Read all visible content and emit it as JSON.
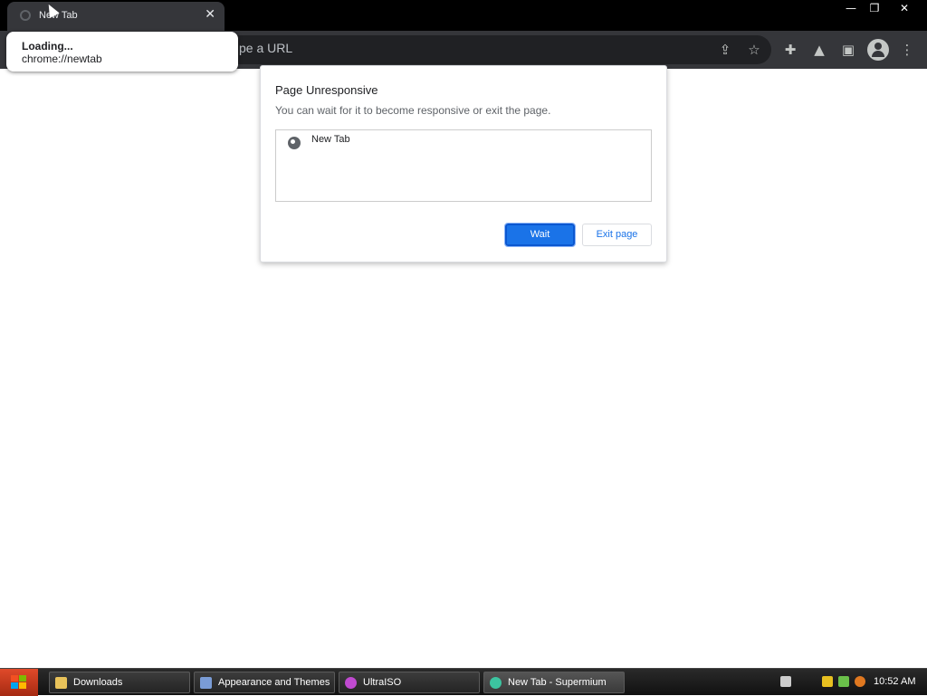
{
  "window": {
    "tab_title": "New Tab",
    "tab_close": "✕",
    "min": "—",
    "max": "❐",
    "close": "✕"
  },
  "toolbar": {
    "omnibox_placeholder": "pe a URL",
    "share": "⇪",
    "star": "☆",
    "extensions": "✚",
    "labs": "▲",
    "side_panel": "▣",
    "menu": "⋮"
  },
  "hovercard": {
    "title": "Loading...",
    "url": "chrome://newtab"
  },
  "dialog": {
    "title": "Page Unresponsive",
    "message": "You can wait for it to become responsive or exit the page.",
    "pages": [
      {
        "label": "New Tab"
      }
    ],
    "wait_label": "Wait",
    "exit_label": "Exit page"
  },
  "taskbar": {
    "tasks": [
      {
        "label": "Downloads",
        "icon_color": "#e8c25a"
      },
      {
        "label": "Appearance and Themes",
        "icon_color": "#7a9cd6"
      },
      {
        "label": "UltraISO",
        "icon_color": "#c04ad0"
      },
      {
        "label": "New Tab - Supermium",
        "icon_color": "#3cc4a0"
      }
    ],
    "clock": "10:52 AM"
  },
  "colors": {
    "accent": "#1a73e8",
    "toolbar": "#35363a",
    "titlebar": "#000000"
  }
}
